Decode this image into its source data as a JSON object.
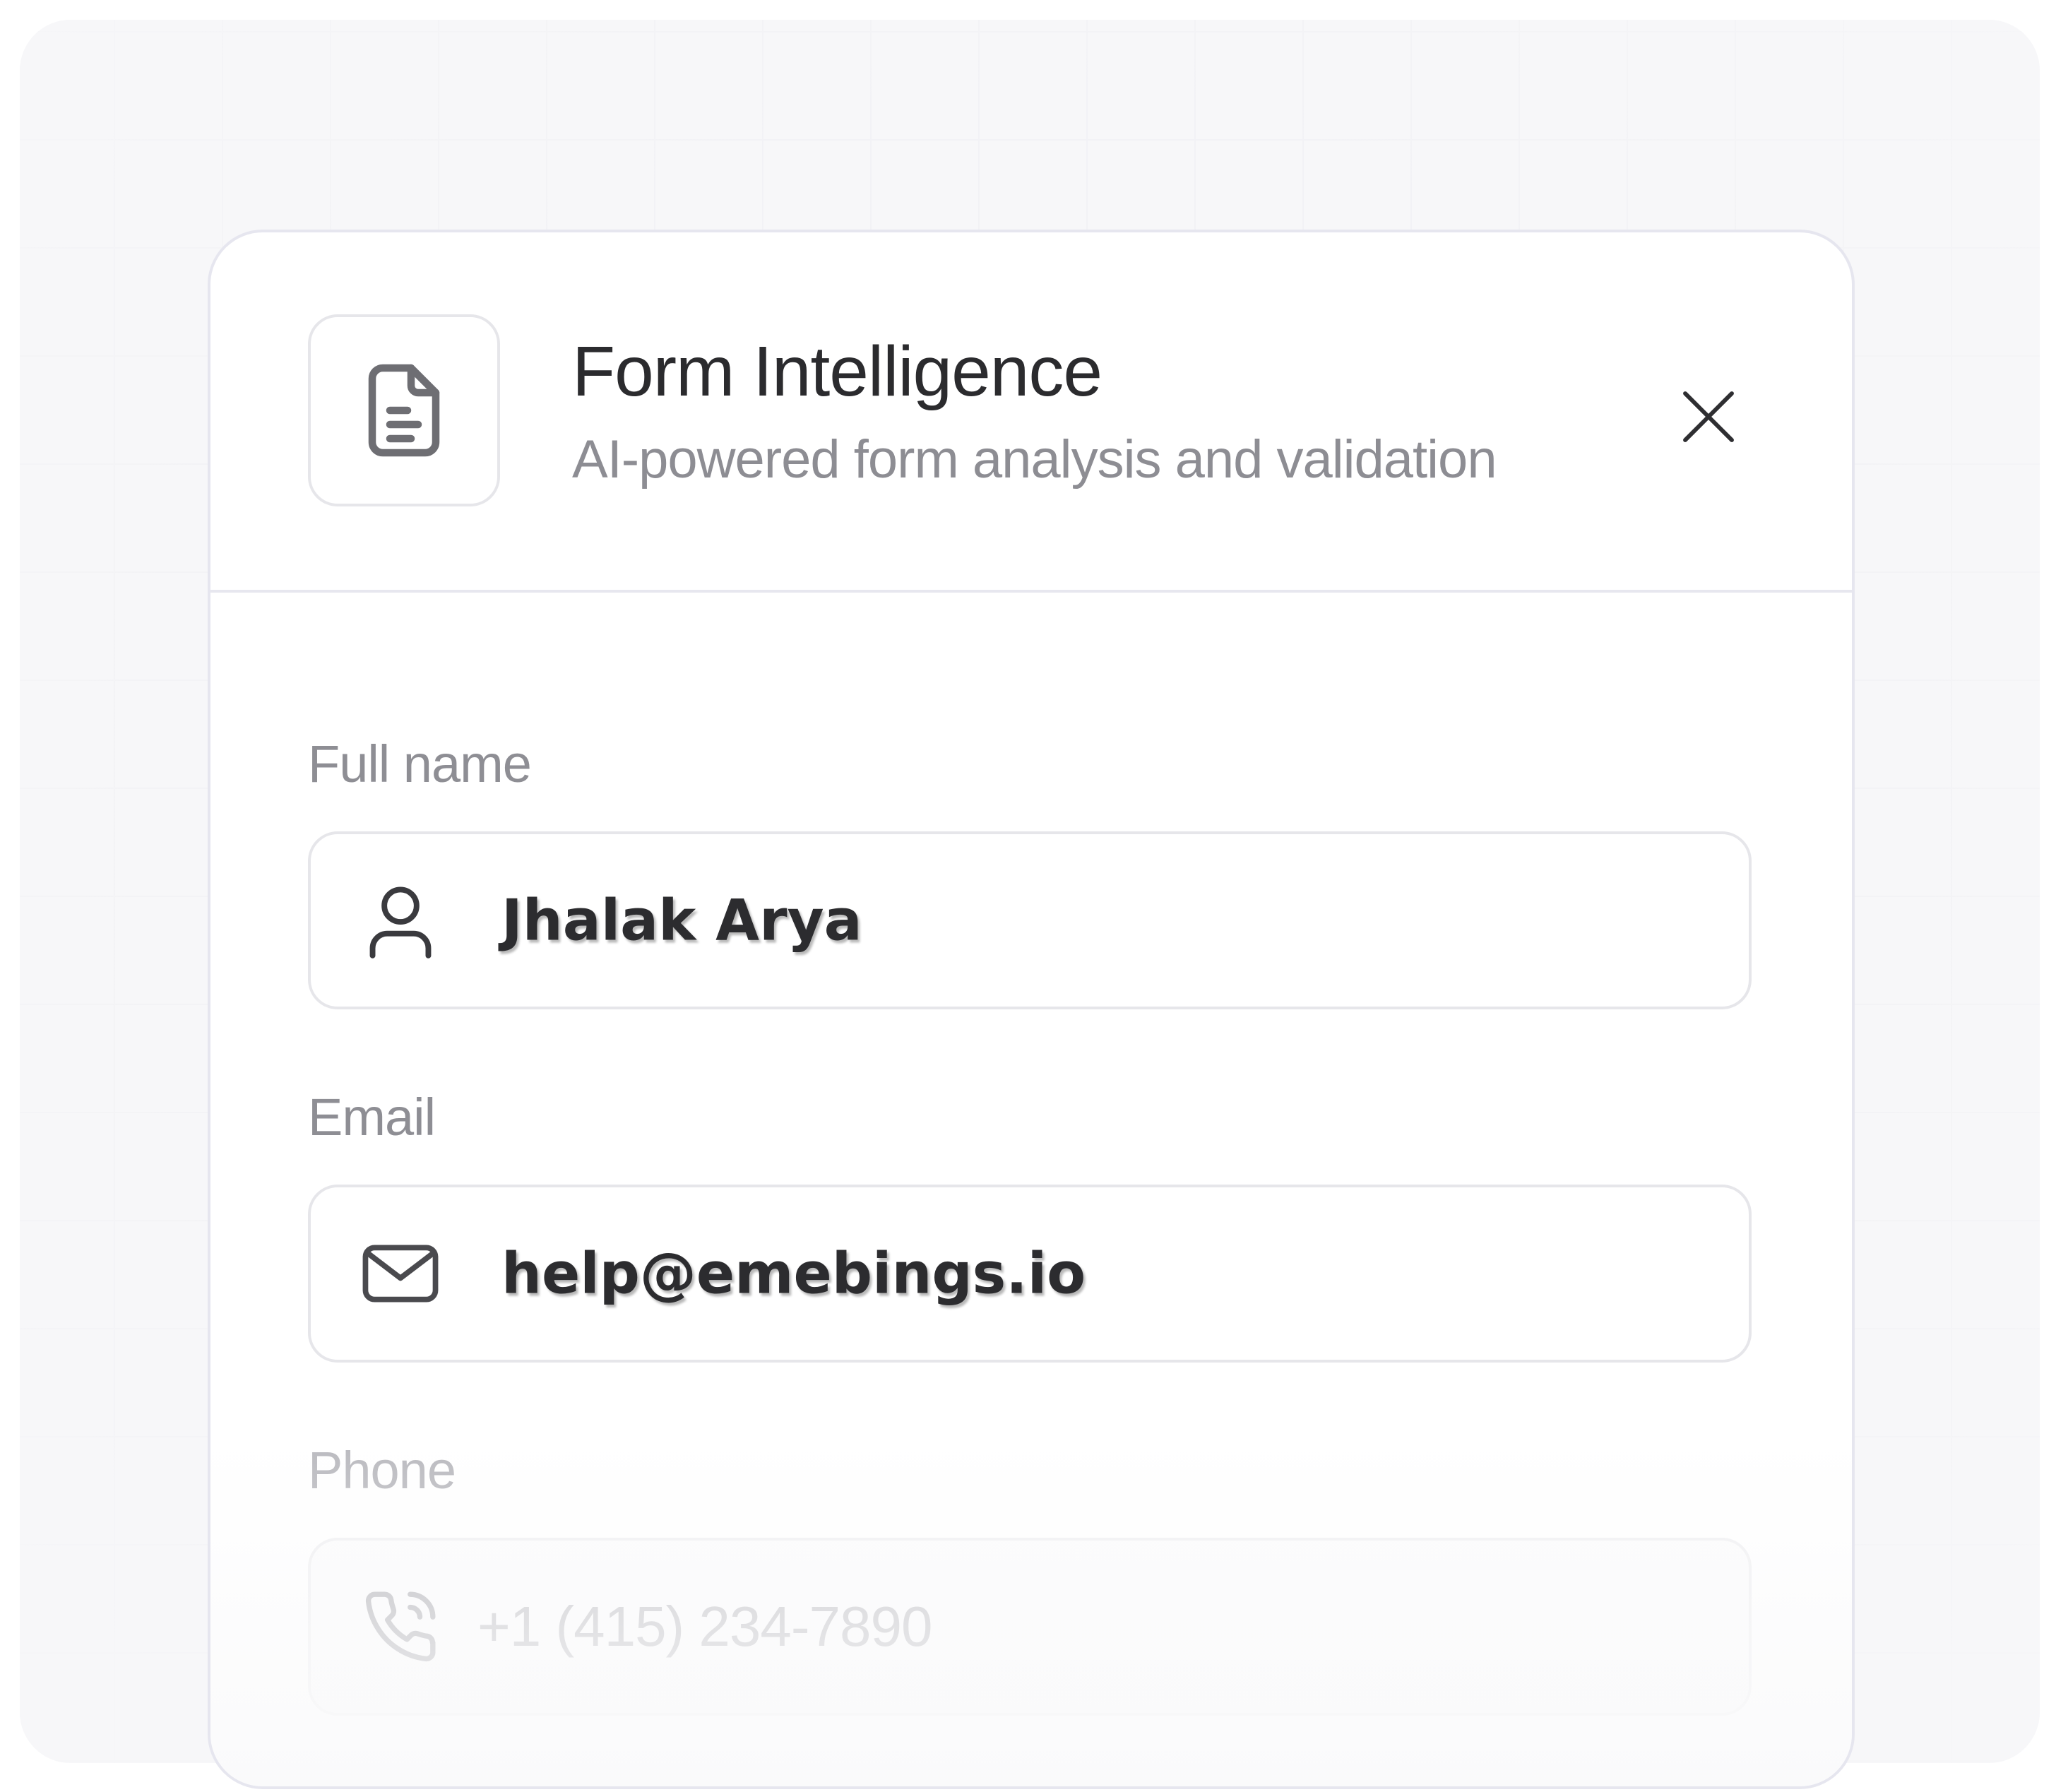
{
  "dialog": {
    "title": "Form Intelligence",
    "subtitle": "AI-powered form analysis and validation",
    "header_icon": "document-icon",
    "close_icon": "close-icon"
  },
  "form": {
    "full_name": {
      "label": "Full name",
      "value": "Jhalak Arya",
      "icon": "user-icon"
    },
    "email": {
      "label": "Email",
      "value": "help@emebings.io",
      "icon": "mail-icon"
    },
    "phone": {
      "label": "Phone",
      "placeholder": "+1 (415) 234-7890",
      "icon": "phone-icon"
    }
  },
  "colors": {
    "background": "#f7f7f9",
    "card": "#ffffff",
    "border": "#e6e6ea",
    "title_text": "#2b2b2e",
    "muted_text": "#8d8d93",
    "placeholder_text": "#c4c4c8"
  }
}
